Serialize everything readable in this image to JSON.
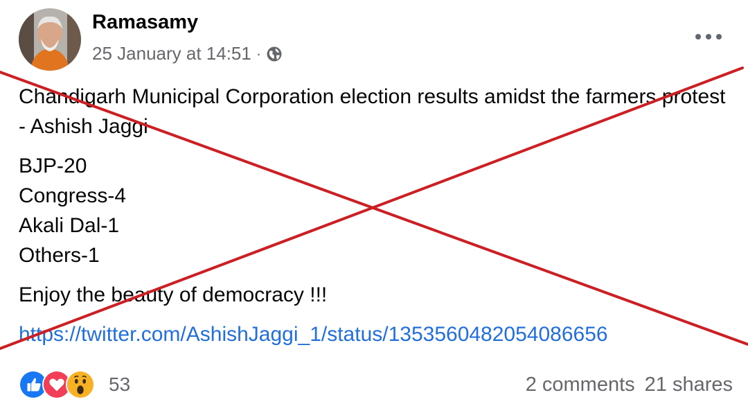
{
  "post": {
    "author": "Ramasamy",
    "timestamp": "25 January at 14:51",
    "separator": "·",
    "privacy_icon": "globe-icon",
    "menu_icon": "more-options-icon",
    "text": {
      "intro": "Chandigarh Municipal Corporation election results amidst the farmers protest - Ashish Jaggi",
      "results": [
        "BJP-20",
        "Congress-4",
        "Akali Dal-1",
        "Others-1"
      ],
      "closing": "Enjoy the beauty of democracy !!!",
      "link": "https://twitter.com/AshishJaggi_1/status/1353560482054086656"
    }
  },
  "footer": {
    "reaction_icons": [
      "like-icon",
      "love-icon",
      "wow-icon"
    ],
    "reaction_count": "53",
    "comments": "2 comments",
    "shares": "21 shares"
  },
  "overlay": {
    "type": "red-cross",
    "color": "#cc1f24"
  },
  "colors": {
    "link": "#216fdb",
    "secondary_text": "#65676b",
    "like_blue": "#1877f2",
    "love_red": "#f33e58",
    "wow_yellow": "#f7b125"
  }
}
